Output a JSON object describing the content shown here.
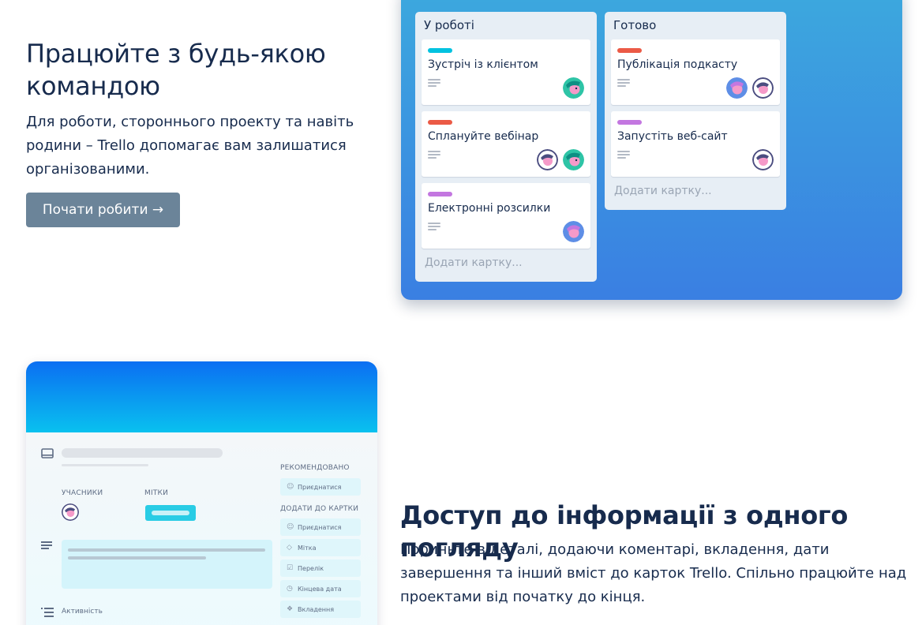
{
  "section1": {
    "title": "Працюйте з будь-якою командою",
    "description": "Для роботи, стороннього проекту та навіть родини – Trello допомагає вам залишатися організованими.",
    "cta_label": "Почати робити →"
  },
  "board": {
    "lists": [
      {
        "title": "У роботі",
        "cards": [
          {
            "text": "Зустріч із клієнтом",
            "label_color": "#00c2e0"
          },
          {
            "text": "Сплануйте вебінар",
            "label_color": "#eb5a46"
          },
          {
            "text": "Електронні розсилки",
            "label_color": "#c377e0"
          }
        ],
        "add_label": "Додати картку..."
      },
      {
        "title": "Готово",
        "cards": [
          {
            "text": "Публікація подкасту",
            "label_color": "#eb5a46"
          },
          {
            "text": "Запустіть веб-сайт",
            "label_color": "#c377e0"
          }
        ],
        "add_label": "Додати картку..."
      }
    ]
  },
  "detail": {
    "members_head": "Учасники",
    "labels_head": "Мітки",
    "recommended_head": "Рекомендовано",
    "add_to_card_head": "Додати до картки",
    "recommended": [
      {
        "label": "Приєднатися",
        "icon": "person-icon"
      }
    ],
    "add_items": [
      {
        "label": "Приєднатися",
        "icon": "person-icon"
      },
      {
        "label": "Мітка",
        "icon": "tag-icon"
      },
      {
        "label": "Перелік",
        "icon": "checklist-icon"
      },
      {
        "label": "Кінцева дата",
        "icon": "clock-icon"
      },
      {
        "label": "Вкладення",
        "icon": "paperclip-icon"
      }
    ],
    "activity_label": "Активність",
    "label_chip_color": "#29cce5"
  },
  "section2": {
    "title": "Доступ до інформації з одного погляду",
    "description": "Пориньте в деталі, додаючи коментарі, вкладення, дати завершення та інший вміст до карток Trello. Спільно працюйте над проектами від початку до кінця."
  }
}
